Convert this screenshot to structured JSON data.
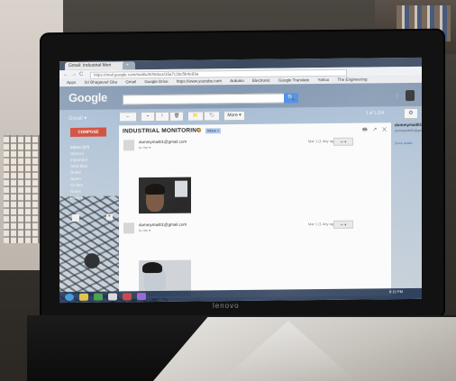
{
  "browser": {
    "tabs": [
      {
        "label": "Gmail: Industrial Mon"
      },
      {
        "label": "+"
      }
    ],
    "nav": {
      "back": "←",
      "forward": "→",
      "reload": "C"
    },
    "url": "https://mail.google.com/mail/u/0/#inbox/15a7c1bc5b4e93a",
    "bookmarks": [
      "Apps",
      "Sri Bhagavad Gita",
      "Gmail",
      "Google Drive",
      "https://www.youtube.com",
      "Arduino",
      "Electronic",
      "Google Translate",
      "Yahoo",
      "The Engineering"
    ]
  },
  "gmail": {
    "logo": "Google",
    "label": "Gmail ▾",
    "search_button": "🔍",
    "compose": "COMPOSE",
    "nav_items": [
      "Inbox (37)",
      "Starred",
      "Important",
      "Sent Mail",
      "Drafts",
      "Spam",
      "Circles",
      "Notes",
      "More ▾"
    ],
    "toolbar": [
      "←",
      "▪",
      "!",
      "🗑",
      "📁",
      "🏷",
      "More ▾"
    ],
    "page_info": "1 of 1,234",
    "settings_icon": "⚙"
  },
  "conversation": {
    "subject": "INDUSTRIAL MONITORING",
    "star": "★",
    "label_tag": "Inbox ×",
    "actions": "🖶 ↗ ✕",
    "messages": [
      {
        "from": "dummymail01@gmail.com",
        "to": "to me ▾",
        "date": "Mar 1 (1 day ago)",
        "reply": "↩ ▾"
      },
      {
        "from": "dummymail01@gmail.com",
        "to": "to me ▾",
        "date": "Mar 1 (1 day ago)",
        "reply": "↩ ▾"
      }
    ]
  },
  "contact": {
    "name": "dummymail01",
    "email": "dummymail01@gmail.com",
    "more": "Show details"
  },
  "taskbar": {
    "clock": "8:15 PM"
  },
  "laptop": {
    "brand": "lenovo"
  }
}
